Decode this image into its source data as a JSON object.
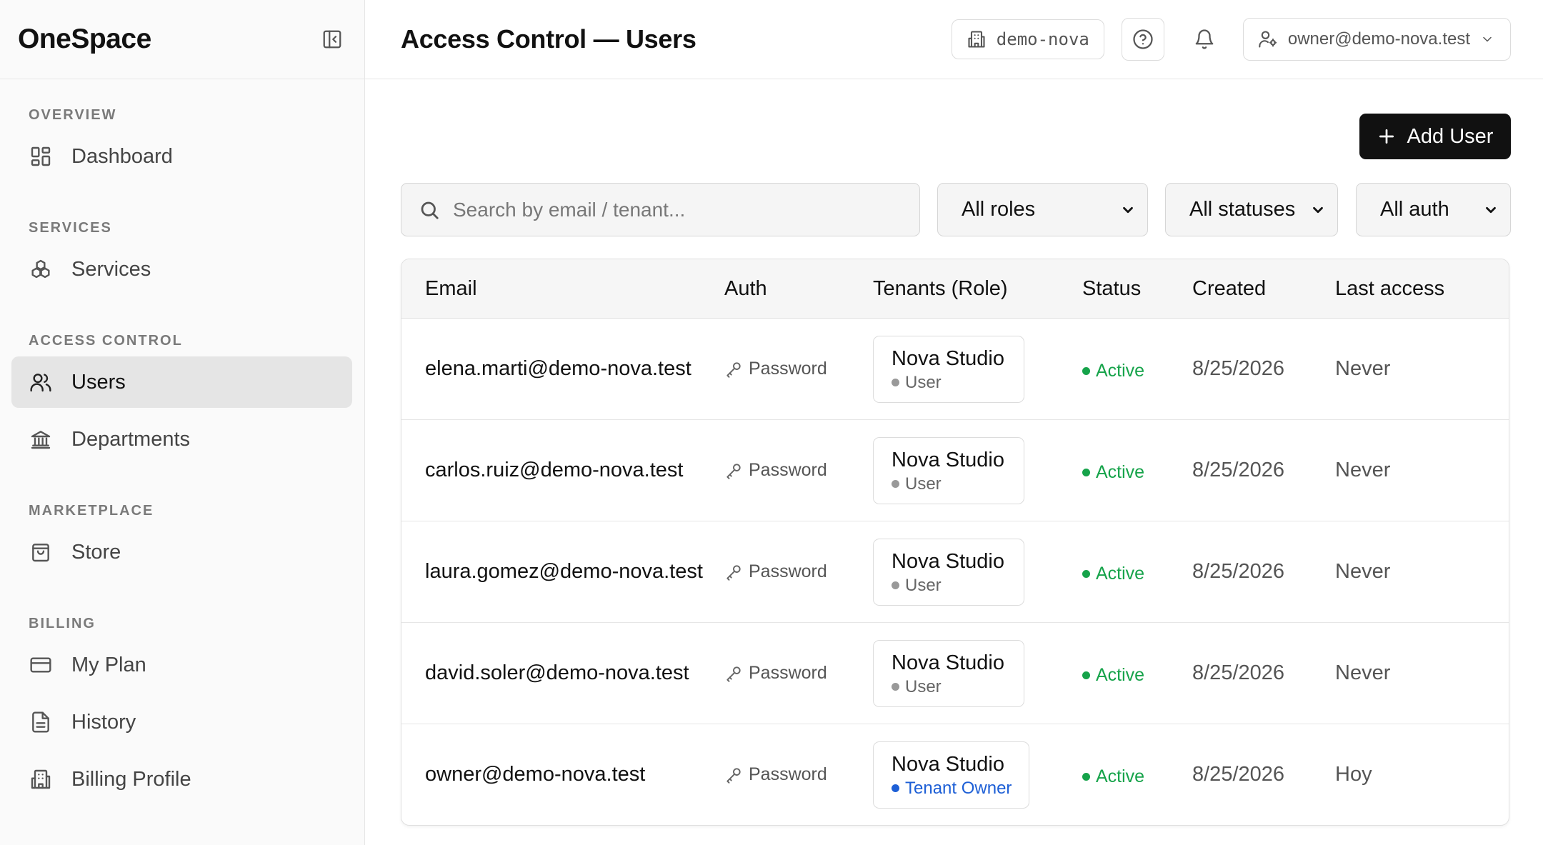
{
  "sidebar": {
    "brand": "OneSpace",
    "sections": [
      {
        "title": "OVERVIEW",
        "items": [
          {
            "label": "Dashboard",
            "icon": "dashboard-icon"
          }
        ]
      },
      {
        "title": "SERVICES",
        "items": [
          {
            "label": "Services",
            "icon": "services-icon"
          }
        ]
      },
      {
        "title": "ACCESS CONTROL",
        "items": [
          {
            "label": "Users",
            "icon": "users-icon",
            "active": true
          },
          {
            "label": "Departments",
            "icon": "building-columns-icon"
          }
        ]
      },
      {
        "title": "MARKETPLACE",
        "items": [
          {
            "label": "Store",
            "icon": "shopping-bag-icon"
          }
        ]
      },
      {
        "title": "BILLING",
        "items": [
          {
            "label": "My Plan",
            "icon": "credit-card-icon"
          },
          {
            "label": "History",
            "icon": "document-icon"
          },
          {
            "label": "Billing Profile",
            "icon": "building-icon"
          }
        ]
      }
    ]
  },
  "header": {
    "title": "Access Control — Users",
    "tenant": "demo-nova",
    "user_email": "owner@demo-nova.test"
  },
  "toolbar": {
    "add_user_label": "Add User"
  },
  "filters": {
    "search_placeholder": "Search by email / tenant...",
    "roles": "All roles",
    "statuses": "All statuses",
    "auth": "All auth"
  },
  "table": {
    "columns": [
      "Email",
      "Auth",
      "Tenants (Role)",
      "Status",
      "Created",
      "Last access"
    ],
    "rows": [
      {
        "email": "elena.marti@demo-nova.test",
        "auth": "Password",
        "tenant": "Nova Studio",
        "role": "User",
        "status": "Active",
        "created": "8/25/2026",
        "last_access": "Never"
      },
      {
        "email": "carlos.ruiz@demo-nova.test",
        "auth": "Password",
        "tenant": "Nova Studio",
        "role": "User",
        "status": "Active",
        "created": "8/25/2026",
        "last_access": "Never"
      },
      {
        "email": "laura.gomez@demo-nova.test",
        "auth": "Password",
        "tenant": "Nova Studio",
        "role": "User",
        "status": "Active",
        "created": "8/25/2026",
        "last_access": "Never"
      },
      {
        "email": "david.soler@demo-nova.test",
        "auth": "Password",
        "tenant": "Nova Studio",
        "role": "User",
        "status": "Active",
        "created": "8/25/2026",
        "last_access": "Never"
      },
      {
        "email": "owner@demo-nova.test",
        "auth": "Password",
        "tenant": "Nova Studio",
        "role": "Tenant Owner",
        "status": "Active",
        "created": "8/25/2026",
        "last_access": "Hoy"
      }
    ]
  },
  "colors": {
    "accent": "#111111",
    "active_status": "#16a34a",
    "owner_role": "#1d5fd6",
    "sidebar_active_bg": "#e5e5e5"
  }
}
